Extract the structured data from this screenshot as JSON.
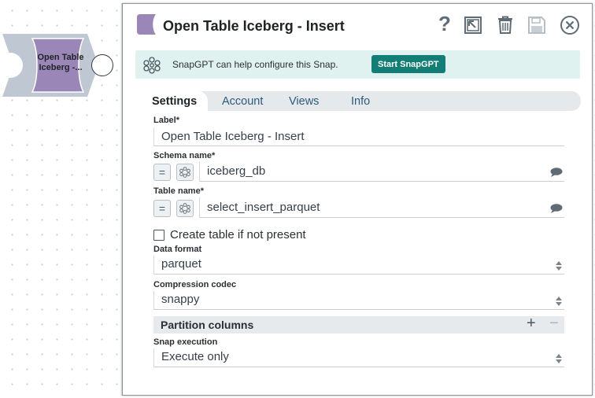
{
  "canvas": {
    "snap_label_line1": "Open Table",
    "snap_label_line2": "Iceberg -..."
  },
  "dialog": {
    "title": "Open Table Iceberg - Insert",
    "help_label": "?",
    "icons": [
      "snap-icon",
      "help-icon",
      "export-icon",
      "delete-icon",
      "save-icon",
      "close-icon"
    ]
  },
  "banner": {
    "text": "SnapGPT can help configure this Snap.",
    "button_label": "Start SnapGPT"
  },
  "tabs": [
    {
      "label": "Settings",
      "active": true
    },
    {
      "label": "Account"
    },
    {
      "label": "Views"
    },
    {
      "label": "Info"
    }
  ],
  "fields": {
    "label": {
      "label": "Label*",
      "value": "Open Table Iceberg - Insert"
    },
    "schema_name": {
      "label": "Schema name*",
      "value": "iceberg_db",
      "eq": "="
    },
    "table_name": {
      "label": "Table name*",
      "value": "select_insert_parquet",
      "eq": "="
    },
    "create_table": {
      "label": "Create table if not present",
      "checked": false
    },
    "data_format": {
      "label": "Data format",
      "value": "parquet"
    },
    "compression_codec": {
      "label": "Compression codec",
      "value": "snappy"
    },
    "partition_columns": {
      "label": "Partition columns",
      "plus": "+",
      "minus": "−"
    },
    "snap_execution": {
      "label": "Snap execution",
      "value": "Execute only"
    }
  },
  "colors": {
    "snap_purple": "#9b86b8",
    "accent_teal": "#127e76",
    "banner_bg": "#e0f2ef",
    "tab_text": "#2c5a7a"
  }
}
